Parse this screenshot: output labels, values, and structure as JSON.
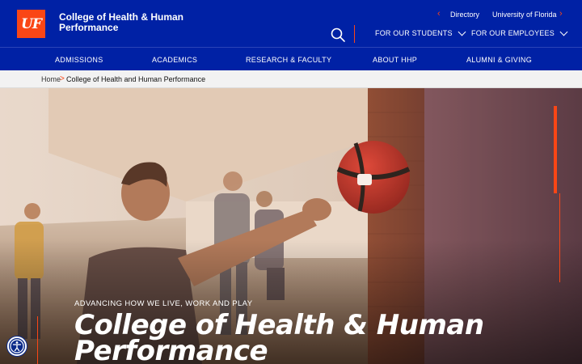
{
  "header": {
    "logo_text": "UF",
    "college_name": "College of Health & Human Performance",
    "utility": {
      "directory": "Directory",
      "university": "University of Florida"
    },
    "audience": {
      "students": "FOR OUR STUDENTS",
      "employees": "FOR OUR EMPLOYEES"
    }
  },
  "nav": {
    "items": [
      {
        "label": "ADMISSIONS"
      },
      {
        "label": "ACADEMICS"
      },
      {
        "label": "RESEARCH & FACULTY"
      },
      {
        "label": "ABOUT HHP"
      },
      {
        "label": "ALUMNI & GIVING"
      }
    ]
  },
  "breadcrumb": {
    "home": "Home",
    "separator": ">",
    "current": "College of Health and Human Performance"
  },
  "hero": {
    "tagline": "ADVANCING HOW WE LIVE, WORK AND PLAY",
    "title": "College of Health & Human Performance"
  },
  "colors": {
    "brand_blue": "#0021a5",
    "brand_orange": "#fa4616"
  },
  "icons": [
    "search-icon",
    "chevron-down-icon",
    "chevron-left-icon",
    "chevron-right-icon",
    "accessibility-icon"
  ]
}
